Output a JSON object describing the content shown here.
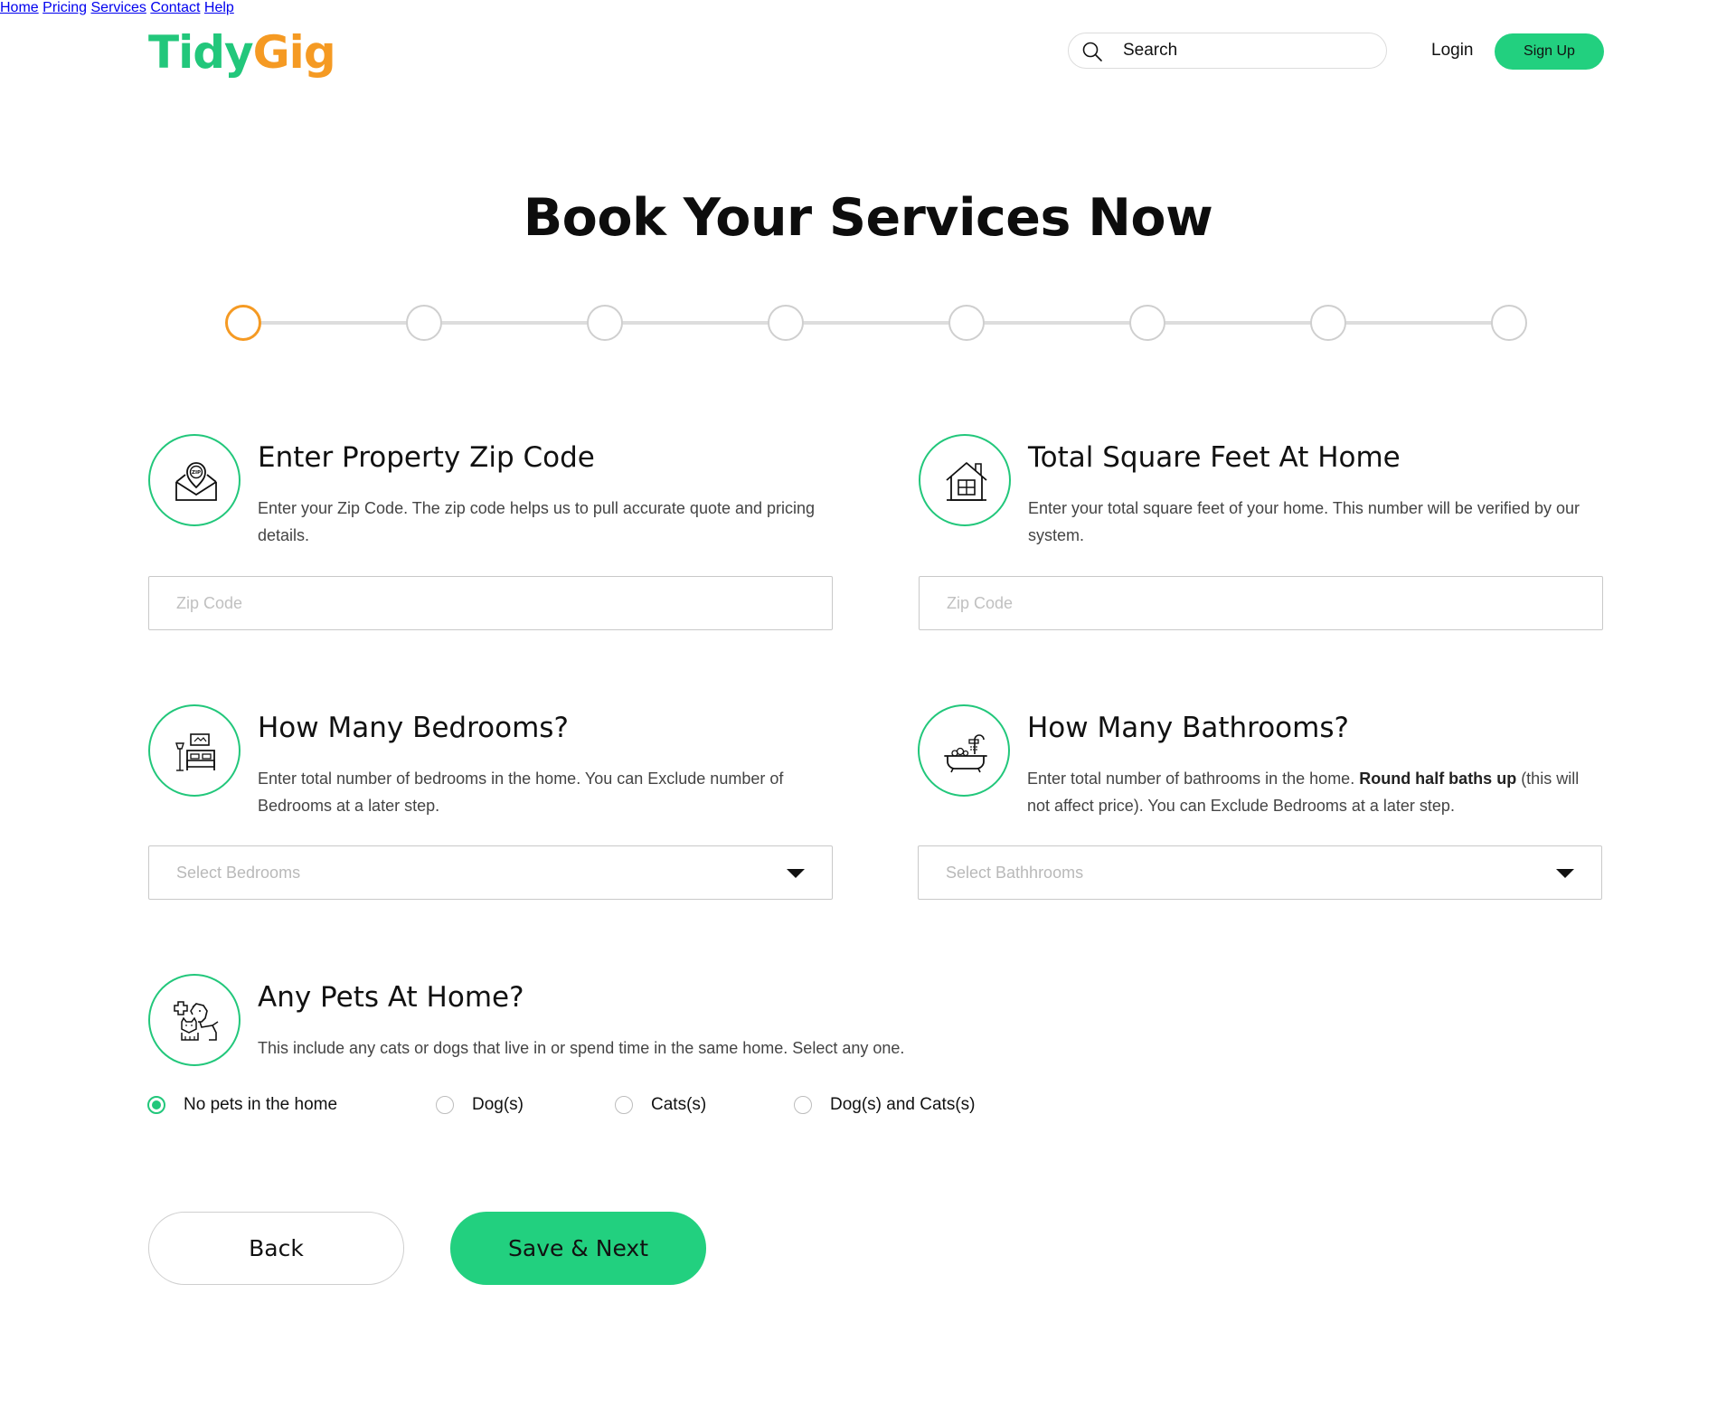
{
  "brand": {
    "part1": "Tidy",
    "part2": "Gig",
    "color_primary": "#22c77b",
    "color_secondary": "#f59a23"
  },
  "nav": {
    "items": [
      "Home",
      "Pricing",
      "Services",
      "Contact",
      "Help"
    ]
  },
  "search": {
    "placeholder": "Search",
    "icon": "search-icon"
  },
  "auth": {
    "login": "Login",
    "signup": "Sign Up"
  },
  "page_title": "Book Your Services Now",
  "stepper": {
    "total_steps": 8,
    "current_step": 1,
    "active_color": "#f59a23"
  },
  "zip": {
    "title": "Enter Property Zip Code",
    "description": "Enter your Zip Code. The zip code helps us to pull accurate quote and pricing details.",
    "placeholder": "Zip Code",
    "icon": "zip-envelope-icon"
  },
  "sqft": {
    "title": "Total Square Feet At Home",
    "description": "Enter your total square feet of your home. This number will be verified by our system.",
    "placeholder": "Zip Code",
    "icon": "house-icon"
  },
  "bedrooms": {
    "title": "How Many Bedrooms?",
    "description": "Enter total number of bedrooms in the home. You can Exclude number of Bedrooms at a later step.",
    "placeholder": "Select Bedrooms",
    "icon": "bed-icon"
  },
  "bathrooms": {
    "title": "How Many Bathrooms?",
    "description_pre": "Enter total number of bathrooms in the home. ",
    "description_bold": "Round half baths up",
    "description_post": " (this will not affect price). You can Exclude Bedrooms at a later step.",
    "placeholder": "Select Bathhrooms",
    "icon": "bathtub-icon"
  },
  "pets": {
    "title": "Any Pets At Home?",
    "description": "This include any cats or dogs that live in or spend time in the same home. Select any one.",
    "icon": "pets-icon",
    "options": [
      "No pets in the home",
      "Dog(s)",
      "Cats(s)",
      "Dog(s) and Cats(s)"
    ],
    "selected": "No pets in the home"
  },
  "actions": {
    "back": "Back",
    "next": "Save & Next"
  }
}
